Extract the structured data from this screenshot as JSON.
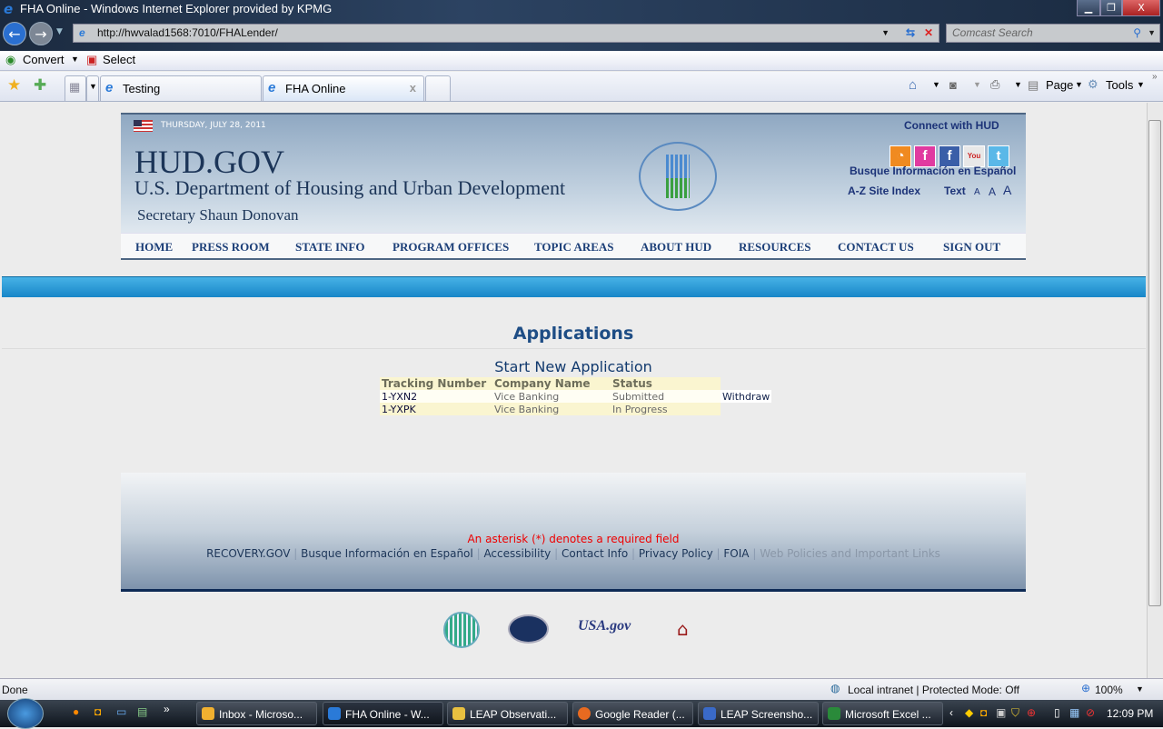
{
  "window": {
    "title": "FHA Online - Windows Internet Explorer provided by KPMG",
    "min": "▁",
    "restore": "❐",
    "close": "X"
  },
  "address": {
    "url": "http://hwvalad1568:7010/FHALender/",
    "search_placeholder": "Comcast Search"
  },
  "command_bar": {
    "convert": "Convert",
    "select": "Select",
    "page": "Page",
    "tools": "Tools"
  },
  "tabs": [
    {
      "label": "Testing"
    },
    {
      "label": "FHA Online",
      "close": "x"
    }
  ],
  "header": {
    "date": "THURSDAY, JULY 28, 2011",
    "site": "HUD.GOV",
    "dept": "U.S. Department of Housing and Urban Development",
    "secretary": "Secretary Shaun Donovan",
    "connect": "Connect with HUD",
    "espanol": "Busque Información en Español",
    "az": "A-Z Site Index",
    "text": "Text",
    "a_small": "A",
    "a_med": "A",
    "a_large": "A"
  },
  "nav": [
    "HOME",
    "PRESS ROOM",
    "STATE INFO",
    "PROGRAM OFFICES",
    "TOPIC AREAS",
    "ABOUT HUD",
    "RESOURCES",
    "CONTACT US",
    "SIGN OUT"
  ],
  "main": {
    "title": "Applications",
    "start_link": "Start New Application",
    "columns": [
      "Tracking Number",
      "Company Name",
      "Status"
    ],
    "rows": [
      {
        "tracking": "1-YXN2",
        "company": "Vice Banking",
        "status": "Submitted",
        "action": "Withdraw"
      },
      {
        "tracking": "1-YXPK",
        "company": "Vice Banking",
        "status": "In Progress"
      }
    ]
  },
  "footer": {
    "required_note": "An asterisk (*) denotes a required field",
    "links": [
      "RECOVERY.GOV",
      "Busque Información en Español",
      "Accessibility",
      "Contact Info",
      "Privacy Policy",
      "FOIA",
      "Web Policies and Important Links"
    ],
    "sep": "|",
    "usa": "USA.gov"
  },
  "status": {
    "text": "Done",
    "zone": "Local intranet | Protected Mode: Off",
    "zoom": "100%"
  },
  "taskbar": {
    "items": [
      "Inbox - Microso...",
      "FHA Online - W...",
      "LEAP Observati...",
      "Google Reader (...",
      "LEAP Screensho...",
      "Microsoft Excel ..."
    ],
    "time": "12:09 PM"
  },
  "colors": {
    "accent_band": "#1786c8",
    "nav_text": "#1c3f78",
    "required": "#ee0000"
  }
}
